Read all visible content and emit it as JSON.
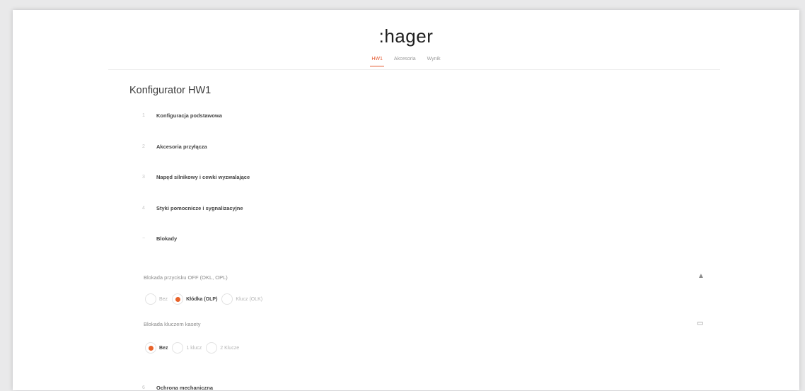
{
  "brand": {
    "logo_text": ":hager"
  },
  "tabs": [
    {
      "label": "HW1",
      "active": true
    },
    {
      "label": "Akcesoria",
      "active": false
    },
    {
      "label": "Wynik",
      "active": false
    }
  ],
  "title": "Konfigurator HW1",
  "sections": [
    {
      "num": "1",
      "label": "Konfiguracja podstawowa"
    },
    {
      "num": "2",
      "label": "Akcesoria przyłącza"
    },
    {
      "num": "3",
      "label": "Napęd silnikowy i cewki wyzwalające"
    },
    {
      "num": "4",
      "label": "Styki pomocnicze i sygnalizacyjne"
    },
    {
      "num": "−",
      "label": "Blokady"
    },
    {
      "num": "6",
      "label": "Ochrona mechaniczna"
    }
  ],
  "blokady": {
    "group1": {
      "label": "Blokada przycisku OFF (OKL, OPL)",
      "icon": "lock-icon",
      "options": [
        {
          "label": "Bez",
          "selected": false
        },
        {
          "label": "Kłódka (OLP)",
          "selected": true
        },
        {
          "label": "Klucz (OLK)",
          "selected": false
        }
      ]
    },
    "group2": {
      "label": "Blokada kluczem kasety",
      "icon": "monitor-icon",
      "options": [
        {
          "label": "Bez",
          "selected": true
        },
        {
          "label": "1 klucz",
          "selected": false
        },
        {
          "label": "2 Klucze",
          "selected": false
        }
      ]
    }
  },
  "colors": {
    "accent": "#e8622a",
    "background": "#ffffff",
    "canvas": "#e9e9ea"
  }
}
